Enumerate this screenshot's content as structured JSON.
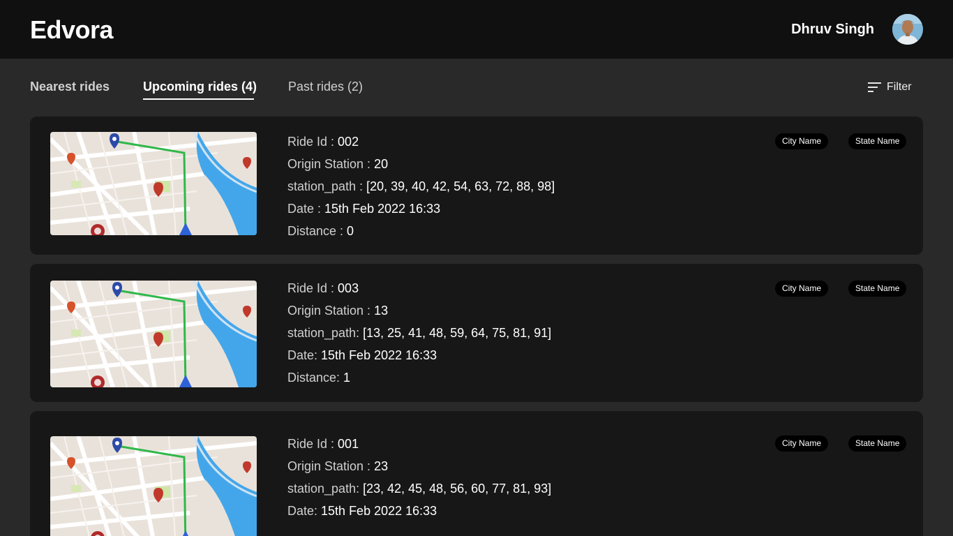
{
  "header": {
    "brand": "Edvora",
    "user_name": "Dhruv Singh"
  },
  "tabs": [
    {
      "label": "Nearest rides",
      "active": false
    },
    {
      "label": "Upcoming rides (4)",
      "active": true
    },
    {
      "label": "Past rides (2)",
      "active": false
    }
  ],
  "filter": {
    "label": "Filter",
    "icon": "filter-lines-icon"
  },
  "rides": [
    {
      "id_label": "Ride Id : ",
      "id": "002",
      "origin_label": "Origin Station : ",
      "origin": "20",
      "path_label": "station_path : ",
      "path": "[20, 39, 40, 42, 54, 63, 72, 88, 98]",
      "date_label": "Date : ",
      "date": "15th Feb 2022 16:33",
      "distance_label": "Distance : ",
      "distance": "0",
      "city": "City Name",
      "state": "State Name"
    },
    {
      "id_label": "Ride Id : ",
      "id": "003",
      "origin_label": "Origin Station : ",
      "origin": "13",
      "path_label": "station_path: ",
      "path": "[13, 25, 41, 48, 59, 64, 75, 81, 91]",
      "date_label": "Date: ",
      "date": "15th Feb 2022 16:33",
      "distance_label": "Distance: ",
      "distance": "1",
      "city": "City Name",
      "state": "State Name"
    },
    {
      "id_label": "Ride Id : ",
      "id": "001",
      "origin_label": "Origin Station : ",
      "origin": "23",
      "path_label": "station_path: ",
      "path": "[23, 42, 45, 48, 56, 60, 77, 81, 93]",
      "date_label": "Date: ",
      "date": "15th Feb 2022 16:33",
      "city": "City Name",
      "state": "State Name"
    }
  ],
  "colors": {
    "header_bg": "#101010",
    "page_bg": "#292929",
    "card_bg": "#171717",
    "pill_bg": "#000000",
    "route_green": "#2fb84a",
    "river_blue": "#3d9be0"
  }
}
